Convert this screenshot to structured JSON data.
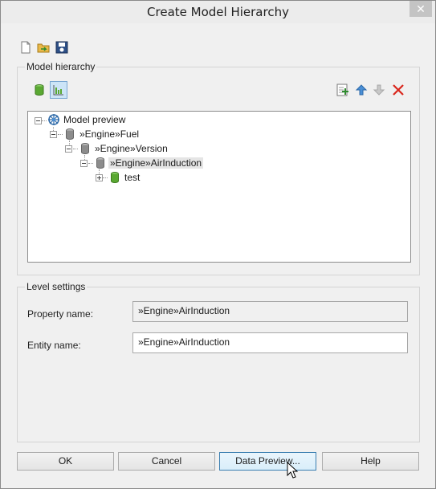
{
  "window": {
    "title": "Create Model Hierarchy",
    "close_glyph": "✕"
  },
  "toolbar": {
    "icons": [
      "new-file-icon",
      "open-folder-icon",
      "save-icon"
    ]
  },
  "model_hierarchy": {
    "label": "Model hierarchy",
    "left_icons": [
      "entity-icon",
      "hierarchy-view-icon"
    ],
    "right_icons": [
      "add-level-icon",
      "move-up-icon",
      "move-down-icon",
      "delete-icon"
    ],
    "tree": {
      "root": "Model preview",
      "level1": "»Engine»Fuel",
      "level2": "»Engine»Version",
      "level3": "»Engine»AirInduction",
      "level4": "test"
    }
  },
  "level_settings": {
    "label": "Level settings",
    "property_name_label": "Property name:",
    "property_name_value": "»Engine»AirInduction",
    "entity_name_label": "Entity name:",
    "entity_name_value": "»Engine»AirInduction"
  },
  "buttons": {
    "ok": "OK",
    "cancel": "Cancel",
    "data_preview": "Data Preview...",
    "help": "Help"
  },
  "colors": {
    "window_bg": "#f0f0f0",
    "db_green": "#5aa832",
    "db_gray": "#8c8c8c",
    "delete_red": "#d9261c",
    "arrow_blue": "#4a8fd6"
  }
}
